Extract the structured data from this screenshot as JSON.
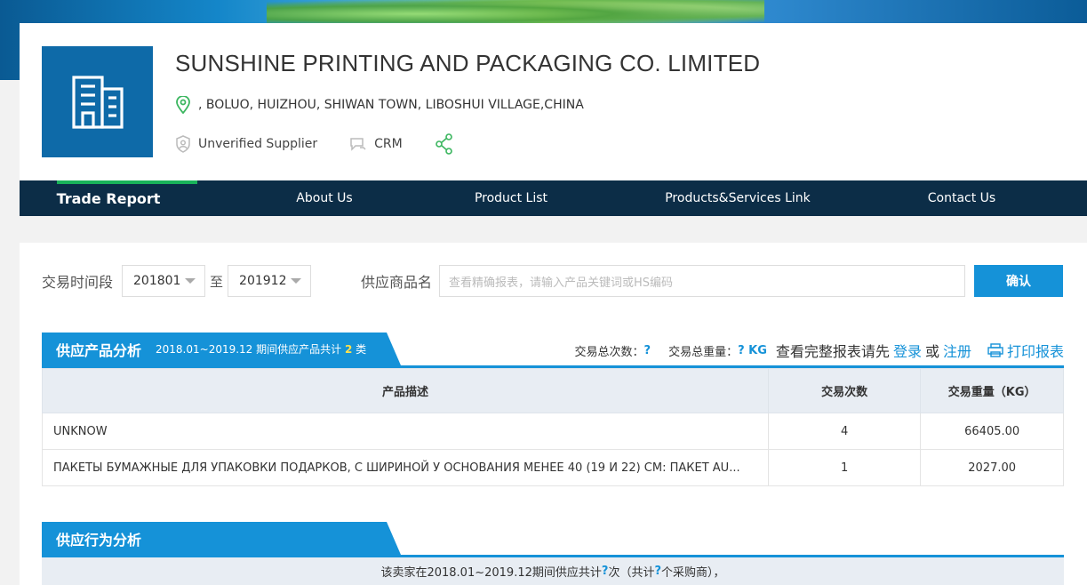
{
  "company": {
    "name": "SUNSHINE PRINTING AND PACKAGING CO. LIMITED",
    "address": ", BOLUO, HUIZHOU, SHIWAN TOWN, LIBOSHUI VILLAGE,CHINA",
    "supplier_status": "Unverified Supplier",
    "crm_label": "CRM"
  },
  "nav": {
    "tabs": [
      {
        "label": "Trade Report",
        "active": true
      },
      {
        "label": "About Us",
        "active": false
      },
      {
        "label": "Product List",
        "active": false
      },
      {
        "label": "Products&Services Link",
        "active": false
      },
      {
        "label": "Contact Us",
        "active": false
      }
    ]
  },
  "filter": {
    "period_label": "交易时间段",
    "from": "201801",
    "to_label": "至",
    "to": "201912",
    "product_label": "供应商品名",
    "search_placeholder": "查看精确报表，请输入产品关键词或HS编码",
    "confirm_label": "确认"
  },
  "product_section": {
    "title": "供应产品分析",
    "subtitle_pre": "2018.01~2019.12 期间供应产品共计",
    "count": "2",
    "subtitle_post": "类",
    "total_count_label": "交易总次数：",
    "total_count_value": "?",
    "total_weight_label": "交易总重量：",
    "total_weight_value": "? KG",
    "login_prompt": "查看完整报表请先",
    "login_link": "登录",
    "or_text": "或",
    "register_link": "注册",
    "print_label": "打印报表",
    "columns": [
      "产品描述",
      "交易次数",
      "交易重量（KG）"
    ],
    "rows": [
      {
        "desc": "UNKNOW",
        "count": "4",
        "weight": "66405.00"
      },
      {
        "desc": "ПАКЕТЫ БУМАЖНЫЕ ДЛЯ УПАКОВКИ ПОДАРКОВ, С ШИРИНОЙ У ОСНОВАНИЯ МЕНЕЕ 40 (19 И 22) СМ: ПАКЕТ AU...",
        "count": "1",
        "weight": "2027.00"
      }
    ]
  },
  "behavior_section": {
    "title": "供应行为分析",
    "summary_pre": "该卖家在2018.01~2019.12期间供应共计",
    "summary_q1": "?",
    "summary_mid": "次（共计",
    "summary_q2": "?",
    "summary_post": "个采购商），"
  }
}
